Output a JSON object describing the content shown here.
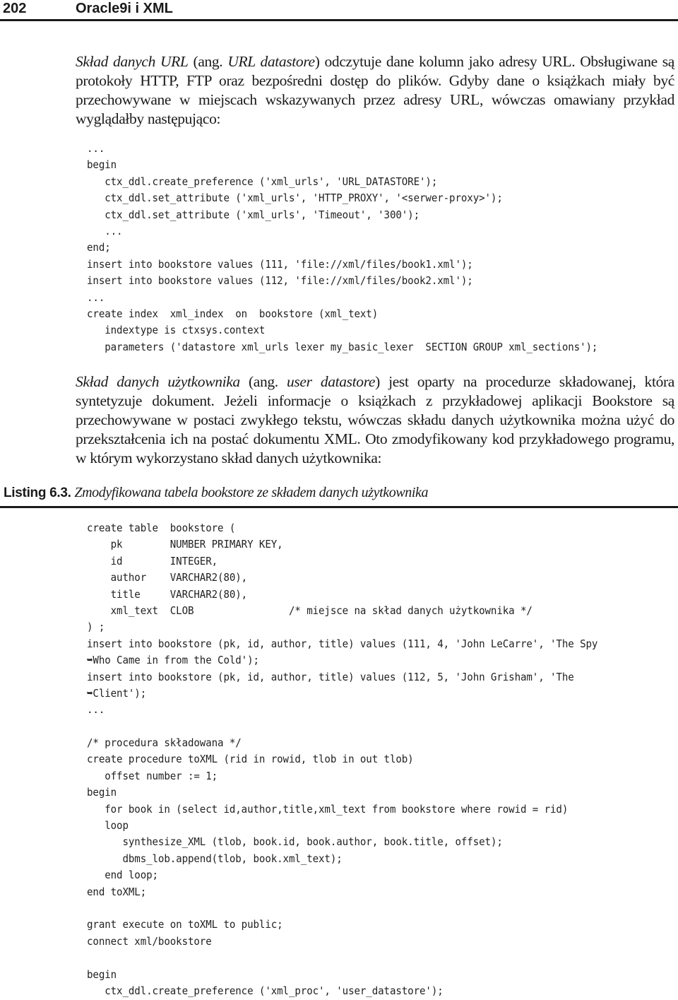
{
  "header": {
    "page_number": "202",
    "running_title": "Oracle9i i XML"
  },
  "paragraph1": {
    "term": "Skład danych URL",
    "ang_prefix": " (ang. ",
    "term_en": "URL datastore",
    "rest": ") odczytuje dane kolumn jako adresy URL. Obsługiwane są protokoły HTTP, FTP oraz bezpośredni dostęp do plików. Gdyby dane o książkach miały być przechowywane w miejscach wskazywanych przez adresy URL, wówczas omawiany przykład wyglądałby następująco:"
  },
  "code1": {
    "lines": [
      "...",
      "begin",
      "   ctx_ddl.create_preference ('xml_urls', 'URL_DATASTORE');",
      "   ctx_ddl.set_attribute ('xml_urls', 'HTTP_PROXY', '<serwer-proxy>');",
      "   ctx_ddl.set_attribute ('xml_urls', 'Timeout', '300');",
      "   ...",
      "end;",
      "insert into bookstore values (111, 'file://xml/files/book1.xml');",
      "insert into bookstore values (112, 'file://xml/files/book2.xml');",
      "...",
      "create index  xml_index  on  bookstore (xml_text)",
      "   indextype is ctxsys.context",
      "   parameters ('datastore xml_urls lexer my_basic_lexer  SECTION GROUP xml_sections');"
    ]
  },
  "paragraph2": {
    "term": "Skład danych użytkownika",
    "ang_prefix": " (ang. ",
    "term_en": "user datastore",
    "rest": ") jest oparty na procedurze składowanej, która syntetyzuje dokument. Jeżeli informacje o książkach z przykładowej aplikacji Bookstore są przechowywane w postaci zwykłego tekstu, wówczas składu danych użytkownika można użyć do przekształcenia ich na postać dokumentu XML. Oto zmodyfikowany kod przykładowego programu, w którym wykorzystano skład danych użytkownika:"
  },
  "listing": {
    "label": "Listing 6.3.",
    "title": "Zmodyfikowana tabela bookstore ze składem danych użytkownika"
  },
  "code2": {
    "lines": [
      "create table  bookstore (",
      "    pk        NUMBER PRIMARY KEY,",
      "    id        INTEGER,",
      "    author    VARCHAR2(80),",
      "    title     VARCHAR2(80),",
      "    xml_text  CLOB                /* miejsce na skład danych użytkownika */",
      ") ;",
      "insert into bookstore (pk, id, author, title) values (111, 4, 'John LeCarre', 'The Spy",
      "➥Who Came in from the Cold');",
      "insert into bookstore (pk, id, author, title) values (112, 5, 'John Grisham', 'The",
      "➥Client');",
      "...",
      "",
      "/* procedura składowana */",
      "create procedure toXML (rid in rowid, tlob in out tlob)",
      "   offset number := 1;",
      "begin",
      "   for book in (select id,author,title,xml_text from bookstore where rowid = rid)",
      "   loop",
      "      synthesize_XML (tlob, book.id, book.author, book.title, offset);",
      "      dbms_lob.append(tlob, book.xml_text);",
      "   end loop;",
      "end toXML;",
      "",
      "grant execute on toXML to public;",
      "connect xml/bookstore",
      "",
      "begin",
      "   ctx_ddl.create_preference ('xml_proc', 'user_datastore');"
    ]
  }
}
